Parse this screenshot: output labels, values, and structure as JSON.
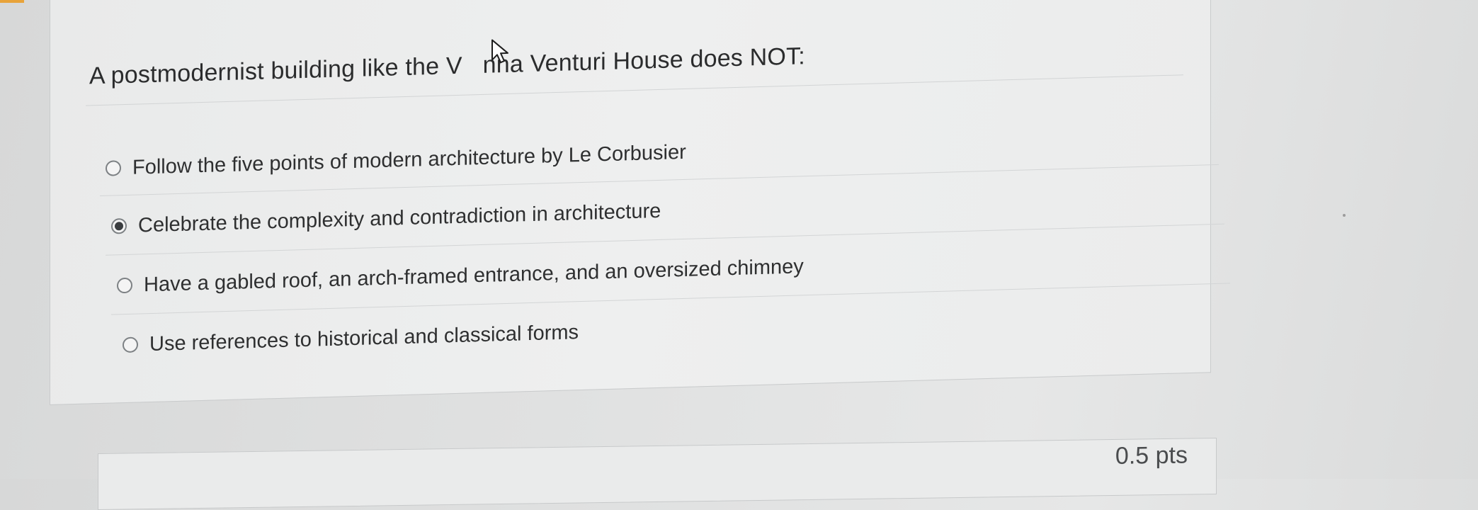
{
  "question": {
    "text": "A postmodernist building like the V   nna Venturi House does NOT:"
  },
  "answers": [
    {
      "label": "Follow the five points of modern architecture by Le Corbusier",
      "selected": false
    },
    {
      "label": "Celebrate the complexity and contradiction in architecture",
      "selected": true
    },
    {
      "label": "Have a gabled roof, an arch-framed entrance, and an oversized chimney",
      "selected": false
    },
    {
      "label": "Use references to historical and classical forms",
      "selected": false
    }
  ],
  "next_question": {
    "points_partial": "0.5 pts"
  },
  "colors": {
    "page_background": "#dfe0e0",
    "card_background": "#eeefef",
    "text": "#2e2f30",
    "accent": "#e8a33a"
  },
  "icons": {
    "cursor": "mouse-pointer-icon",
    "radio": "radio-button-icon"
  }
}
